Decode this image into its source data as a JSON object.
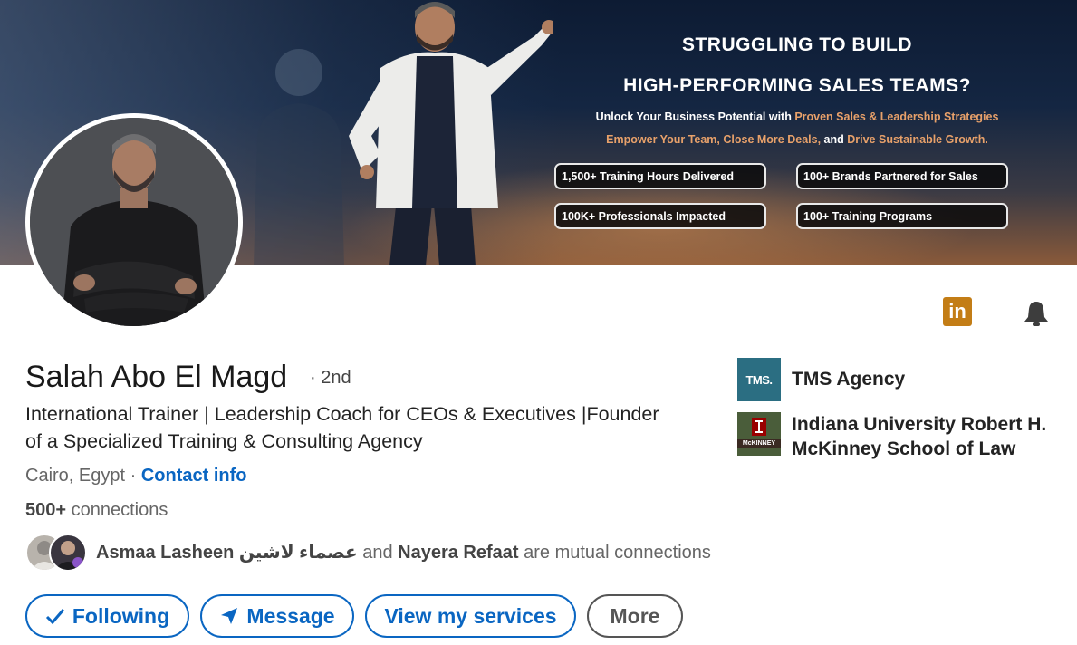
{
  "banner": {
    "line1": "STRUGGLING TO BUILD",
    "line2": "HIGH-PERFORMING SALES TEAMS?",
    "sub1_a": "Unlock Your Business Potential with ",
    "sub1_b": "Proven Sales & Leadership Strategies",
    "sub2_a": "Empower Your Team, Close More Deals,",
    "sub2_b": " and ",
    "sub2_c": "Drive Sustainable Growth.",
    "stats": [
      "1,500+ Training Hours Delivered",
      "100+ Brands Partnered for Sales",
      "100K+ Professionals Impacted",
      "100+ Training Programs"
    ]
  },
  "profile": {
    "name": "Salah Abo El Magd",
    "degree": "· 2nd",
    "headline": "International Trainer | Leadership Coach for CEOs & Executives |Founder of a Specialized Training & Consulting Agency",
    "location": "Cairo, Egypt",
    "separator": " · ",
    "contact_info": "Contact info",
    "connections_count": "500+",
    "connections_label": " connections"
  },
  "mutual": {
    "person1": "Asmaa Lasheen عصماء لاشين",
    "and": " and ",
    "person2": "Nayera Refaat",
    "suffix": " are mutual connections"
  },
  "actions": {
    "following": "Following",
    "message": "Message",
    "services": "View my services",
    "more": "More"
  },
  "orgs": {
    "company": "TMS Agency",
    "company_logo_text": "TMS.",
    "school": "Indiana University Robert H. McKinney School of Law",
    "school_logo_text": "McKINNEY"
  },
  "icons": {
    "linkedin": "in"
  },
  "colors": {
    "accent": "#0a66c2",
    "banner_highlight": "#e8a16a",
    "linkedin_badge": "#c37d16"
  }
}
